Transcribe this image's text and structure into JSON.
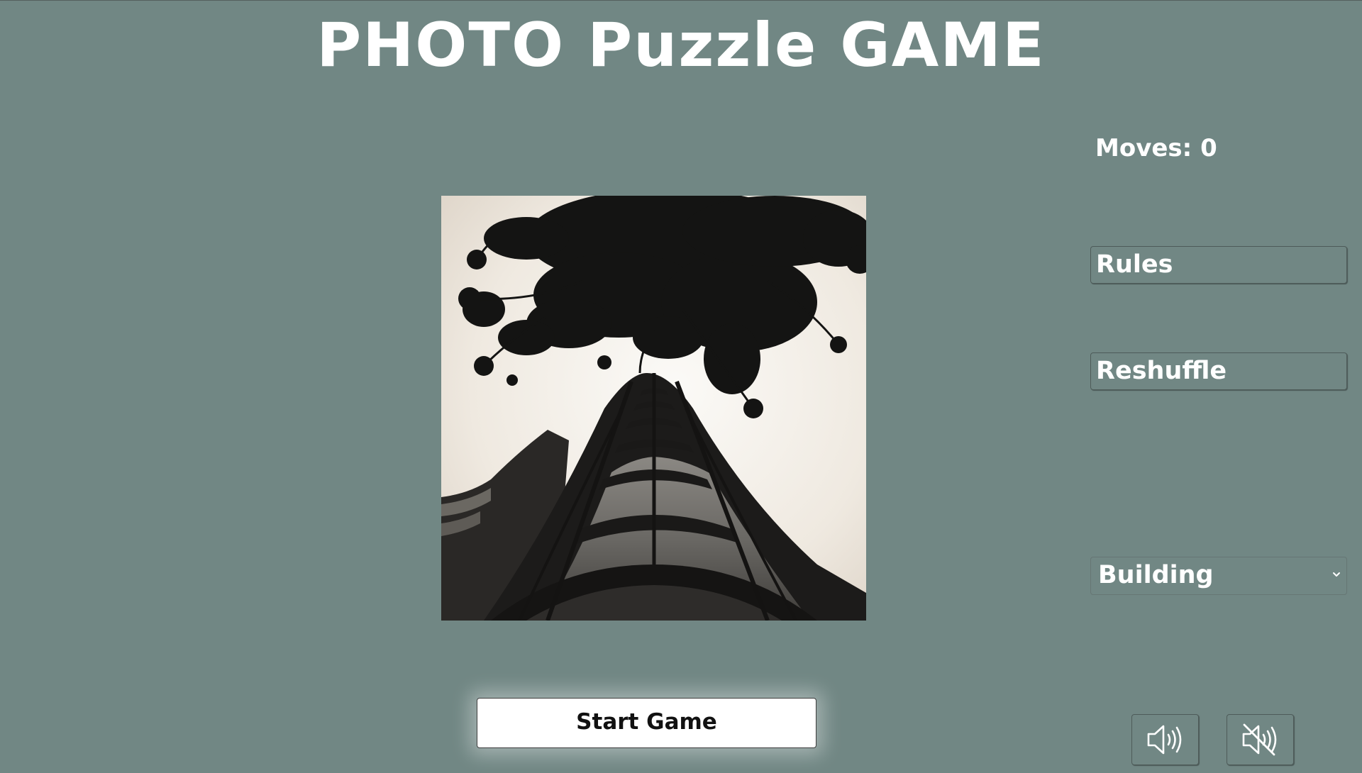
{
  "game": {
    "title": "PHOTO Puzzle GAME",
    "moves_label": "Moves: 0",
    "moves": 0,
    "start_label": "Start Game"
  },
  "sidebar": {
    "rules_label": "Rules",
    "reshuffle_label": "Reshuffle",
    "category_select": {
      "selected": "Building"
    }
  },
  "sound": {
    "on_icon": "speaker-on-icon",
    "off_icon": "speaker-muted-icon"
  },
  "colors": {
    "background": "#718784",
    "text": "#ffffff",
    "start_button_bg": "#ffffff",
    "start_button_text": "#111111"
  }
}
